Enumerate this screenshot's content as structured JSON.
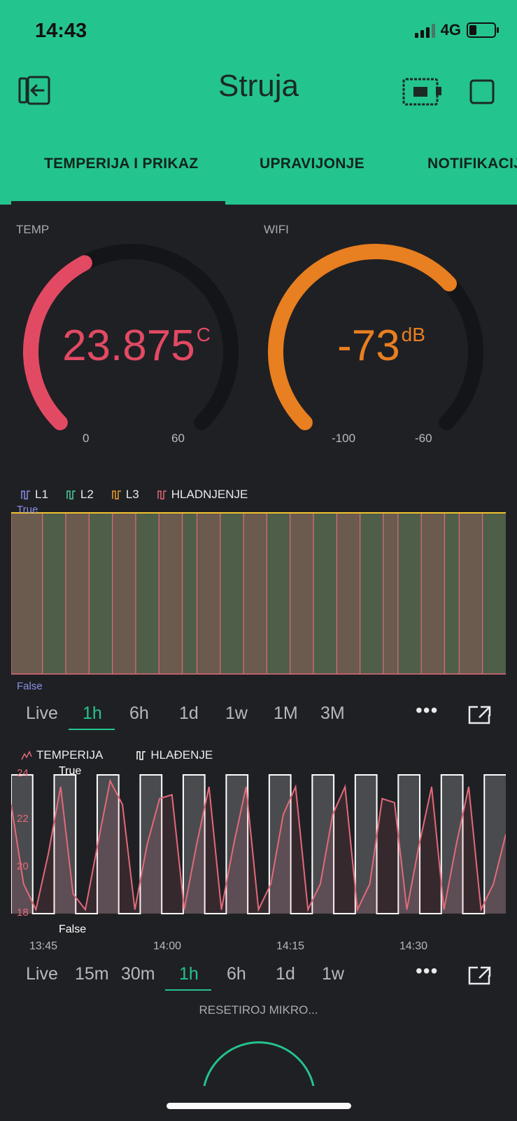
{
  "status_bar": {
    "time": "14:43",
    "network": "4G",
    "battery_level": 0.3,
    "signal_bars": 3
  },
  "header": {
    "title": "Struja",
    "colors": {
      "accent": "#24c48e",
      "background": "#1f2024"
    }
  },
  "tabs": [
    {
      "label": "TEMPERIJA I PRIKAZ",
      "active": true
    },
    {
      "label": "UPRAVIJONJE",
      "active": false
    },
    {
      "label": "NOTIFIKACIJ",
      "active": false
    }
  ],
  "gauges": [
    {
      "label": "TEMP",
      "value": "23.875",
      "unit": "C",
      "min": "0",
      "max": "60",
      "fraction": 0.398,
      "color": "#e24a63"
    },
    {
      "label": "WIFI",
      "value": "-73",
      "unit": "dB",
      "min": "-100",
      "max": "-60",
      "fraction": 0.675,
      "color": "#e87f20"
    }
  ],
  "status_chart": {
    "legend": [
      "L1",
      "L2",
      "L3",
      "HLADNJENJE"
    ],
    "legend_colors": [
      "#8a8fe6",
      "#4bd0a0",
      "#f0a030",
      "#e26a7a"
    ],
    "y_true": "True",
    "y_false": "False",
    "ranges": [
      "Live",
      "1h",
      "6h",
      "1d",
      "1w",
      "1M",
      "3M"
    ],
    "active_range": "1h"
  },
  "temp_chart": {
    "legend": [
      "TEMPERIJA",
      "HLAĐENJE"
    ],
    "y_ticks": [
      "24",
      "22",
      "20",
      "18"
    ],
    "y_true": "True",
    "y_false": "False",
    "x_ticks": [
      "13:45",
      "14:00",
      "14:15",
      "14:30"
    ],
    "ranges": [
      "Live",
      "15m",
      "30m",
      "1h",
      "6h",
      "1d",
      "1w"
    ],
    "active_range": "1h"
  },
  "reset_button": {
    "label": "RESETIROJ MIKRO..."
  },
  "chart_data": [
    {
      "type": "line",
      "title": "",
      "series_names": [
        "L1",
        "L2",
        "L3",
        "HLADNJENJE"
      ],
      "y_values": [
        "False",
        "True"
      ],
      "note_segments": [
        1,
        0,
        1,
        0,
        1,
        0,
        1,
        0,
        1,
        0,
        1,
        0,
        1,
        0,
        1,
        0,
        1,
        0,
        1,
        0,
        1,
        0
      ]
    },
    {
      "type": "line",
      "title": "",
      "x_ticks": [
        "13:45",
        "14:00",
        "14:15",
        "14:30"
      ],
      "ylim": [
        17,
        24
      ],
      "series": [
        {
          "name": "TEMPERIJA",
          "values": [
            22.5,
            18.5,
            17.2,
            20,
            23.4,
            18,
            17.2,
            20.5,
            23.7,
            22.5,
            17.2,
            20.5,
            22.8,
            23,
            17.2,
            20.5,
            23.4,
            17.2,
            20.5,
            23.4,
            17.2,
            18.5,
            22,
            23.4,
            17.2,
            18.5,
            22,
            23.4,
            17.2,
            18.5,
            22.8,
            22.6,
            17.2,
            20.5,
            23.4,
            17.2,
            20.5,
            23.4,
            17.2,
            18.5,
            21
          ]
        },
        {
          "name": "HLAĐENJE",
          "states": [
            1,
            0,
            1,
            0,
            1,
            0,
            1,
            0,
            1,
            0,
            1,
            0,
            1,
            0,
            1,
            0,
            1,
            0,
            1,
            0,
            1,
            0,
            1
          ]
        }
      ]
    }
  ]
}
